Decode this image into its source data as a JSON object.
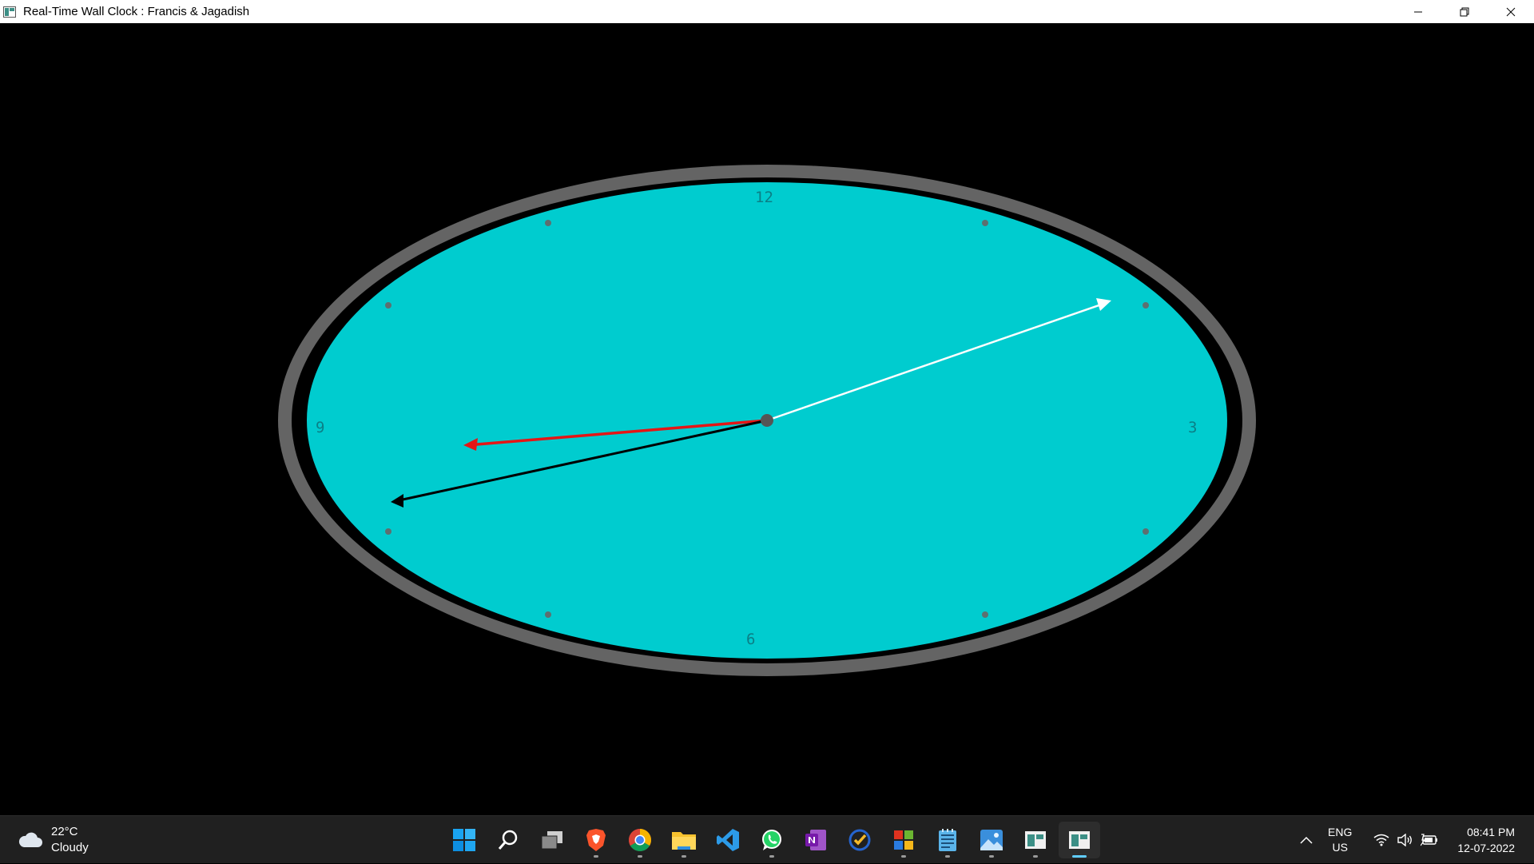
{
  "window": {
    "title": "Real-Time Wall Clock : Francis & Jagadish",
    "controls": [
      "minimize-icon",
      "restore-icon",
      "close-icon"
    ]
  },
  "clock": {
    "numerals": {
      "twelve": "12",
      "three": "3",
      "six": "6",
      "nine": "9"
    },
    "colors": {
      "face": "#00cccf",
      "rim": "#646464",
      "tick_dots": "#5e6f70",
      "hour_hand": "#e51515",
      "minute_hand": "#000000",
      "second_hand": "#ffffff",
      "center_dot": "#555555"
    },
    "time_shown": {
      "hour_hand_points_to": "between 8 and 9",
      "minute_hand_points_to": "about 41",
      "second_hand_points_to": "about 12"
    }
  },
  "taskbar": {
    "weather": {
      "temperature": "22°C",
      "condition": "Cloudy",
      "icon": "cloud-icon"
    },
    "apps": [
      {
        "name": "start-icon",
        "running": false,
        "active": false
      },
      {
        "name": "search-icon",
        "running": false,
        "active": false
      },
      {
        "name": "task-view-icon",
        "running": false,
        "active": false
      },
      {
        "name": "brave-browser-icon",
        "running": true,
        "active": false
      },
      {
        "name": "chrome-icon",
        "running": true,
        "active": false
      },
      {
        "name": "file-explorer-icon",
        "running": true,
        "active": false
      },
      {
        "name": "vscode-icon",
        "running": false,
        "active": false
      },
      {
        "name": "whatsapp-icon",
        "running": true,
        "active": false
      },
      {
        "name": "onenote-icon",
        "running": false,
        "active": false
      },
      {
        "name": "todo-icon",
        "running": false,
        "active": false
      },
      {
        "name": "office-app-icon",
        "running": true,
        "active": false
      },
      {
        "name": "notepad-icon",
        "running": true,
        "active": false
      },
      {
        "name": "photos-icon",
        "running": true,
        "active": false
      },
      {
        "name": "window-app-icon",
        "running": true,
        "active": false
      },
      {
        "name": "clock-app-icon",
        "running": true,
        "active": true
      }
    ],
    "tray": {
      "language": "ENG",
      "region": "US",
      "time": "08:41 PM",
      "date": "12-07-2022",
      "icons": [
        "chevron-up-icon",
        "wifi-icon",
        "volume-icon",
        "battery-icon"
      ]
    }
  }
}
